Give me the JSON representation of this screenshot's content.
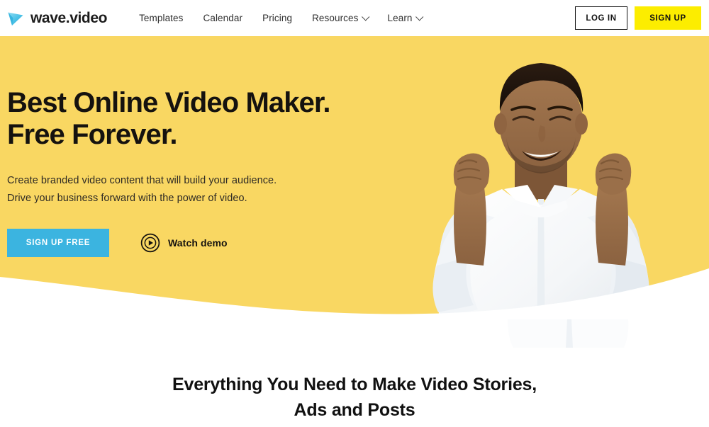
{
  "header": {
    "logo": {
      "text": "wave.video",
      "icon": "play-triangle-logo-icon",
      "color": "#4ec3e8"
    },
    "nav": [
      {
        "label": "Templates",
        "has_dropdown": false
      },
      {
        "label": "Calendar",
        "has_dropdown": false
      },
      {
        "label": "Pricing",
        "has_dropdown": false
      },
      {
        "label": "Resources",
        "has_dropdown": true
      },
      {
        "label": "Learn",
        "has_dropdown": true
      }
    ],
    "login_label": "LOG IN",
    "signup_label": "SIGN UP",
    "signup_color": "#fced00"
  },
  "hero": {
    "title_line1": "Best Online Video Maker.",
    "title_line2": "Free Forever.",
    "sub_line1": "Create branded video content that will build your audience.",
    "sub_line2": "Drive your business forward with the power of video.",
    "cta_label": "SIGN UP FREE",
    "cta_color": "#3bb4e0",
    "watch_label": "Watch demo",
    "watch_icon": "play-circle-icon",
    "background_color": "#f9d762",
    "image_alt": "smiling-man-raised-fists"
  },
  "features": {
    "title_line1": "Everything You Need to Make Video Stories,",
    "title_line2": "Ads and Posts"
  }
}
